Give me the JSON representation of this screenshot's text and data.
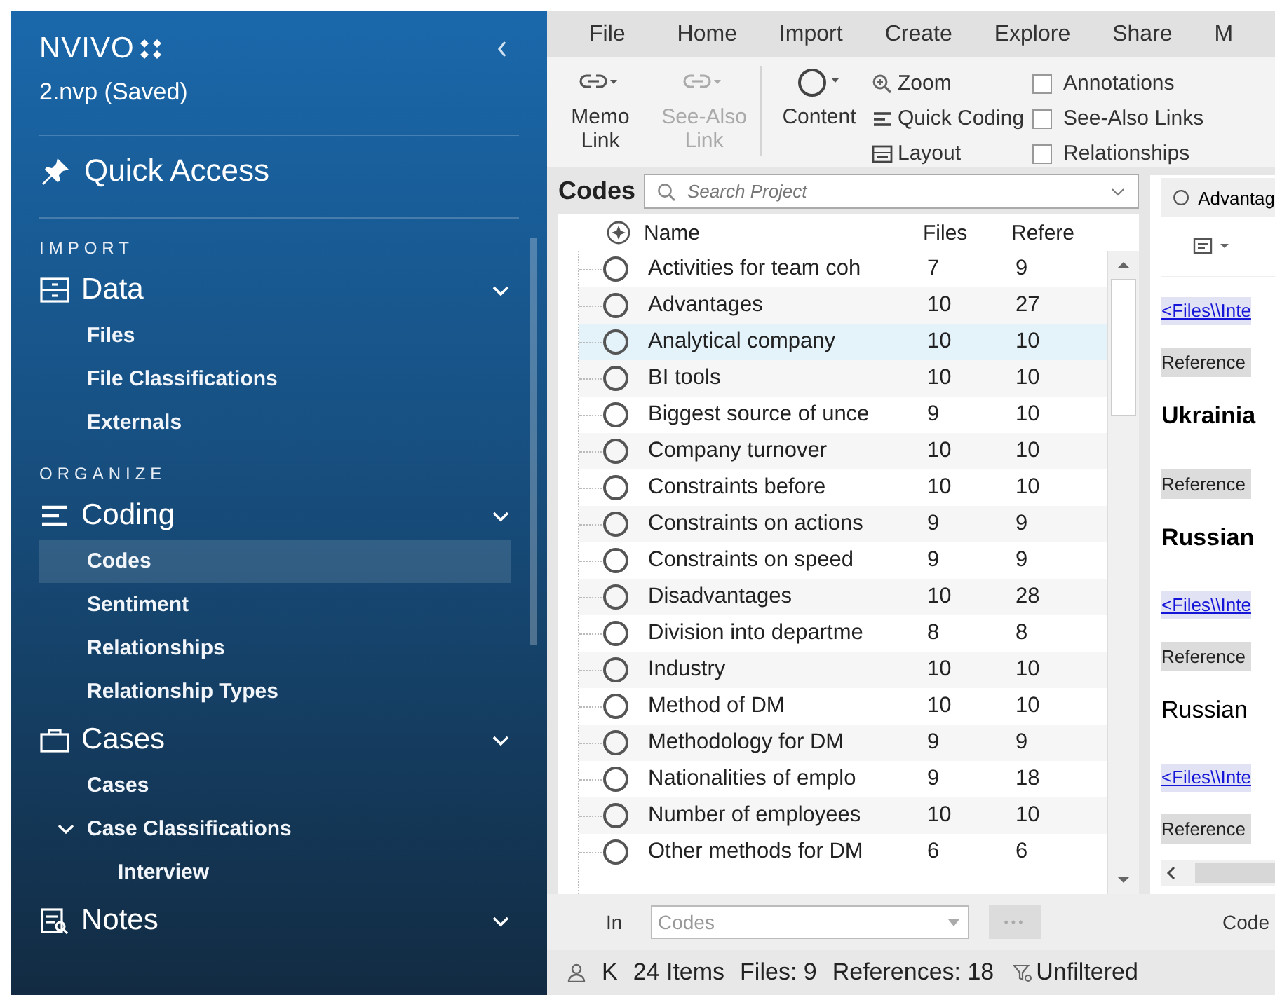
{
  "app": {
    "logo": "NVIVO",
    "project": "2.nvp (Saved)"
  },
  "sidebar": {
    "quick_access": "Quick Access",
    "sections": [
      {
        "heading": "IMPORT",
        "groups": [
          {
            "kind": "data",
            "label": "Data",
            "expanded": true,
            "items": [
              {
                "label": "Files",
                "selected": false
              },
              {
                "label": "File Classifications",
                "selected": false
              },
              {
                "label": "Externals",
                "selected": false
              }
            ]
          }
        ]
      },
      {
        "heading": "ORGANIZE",
        "groups": [
          {
            "kind": "coding",
            "label": "Coding",
            "expanded": true,
            "items": [
              {
                "label": "Codes",
                "selected": true
              },
              {
                "label": "Sentiment",
                "selected": false
              },
              {
                "label": "Relationships",
                "selected": false
              },
              {
                "label": "Relationship Types",
                "selected": false
              }
            ]
          },
          {
            "kind": "cases",
            "label": "Cases",
            "expanded": true,
            "items": [
              {
                "label": "Cases",
                "selected": false
              },
              {
                "label": "Case Classifications",
                "selected": false,
                "expanded": true,
                "children": [
                  {
                    "label": "Interview",
                    "selected": false
                  }
                ]
              }
            ]
          },
          {
            "kind": "notes",
            "label": "Notes"
          }
        ]
      }
    ]
  },
  "menu": [
    {
      "label": "File",
      "selected": false
    },
    {
      "label": "Home",
      "selected": false
    },
    {
      "label": "Import",
      "selected": false
    },
    {
      "label": "Create",
      "selected": false
    },
    {
      "label": "Explore",
      "selected": false
    },
    {
      "label": "Share",
      "selected": false
    },
    {
      "label": "M",
      "selected": false
    }
  ],
  "ribbon": {
    "links": [
      {
        "label": "Memo Link",
        "disabled": false
      },
      {
        "label": "See-Also Link",
        "disabled": true
      }
    ],
    "content": "Content",
    "tools": [
      {
        "kind": "zoom",
        "label": "Zoom"
      },
      {
        "kind": "quick",
        "label": "Quick Coding"
      },
      {
        "kind": "layout",
        "label": "Layout"
      }
    ],
    "checkboxes": [
      {
        "label": "Annotations",
        "checked": false
      },
      {
        "label": "See-Also Links",
        "checked": false
      },
      {
        "label": "Relationships",
        "checked": false
      }
    ]
  },
  "codes": {
    "title": "Codes",
    "search": {
      "placeholder": "Search Project"
    },
    "columns": [
      "Name",
      "Files",
      "Refere"
    ],
    "rows": [
      {
        "name": "Activities for team coh",
        "files": "7",
        "references": "9",
        "selected": false
      },
      {
        "name": "Advantages",
        "files": "10",
        "references": "27",
        "selected": false
      },
      {
        "name": "Analytical company",
        "files": "10",
        "references": "10",
        "selected": true
      },
      {
        "name": "BI tools",
        "files": "10",
        "references": "10",
        "selected": false
      },
      {
        "name": "Biggest source of unce",
        "files": "9",
        "references": "10",
        "selected": false
      },
      {
        "name": "Company turnover",
        "files": "10",
        "references": "10",
        "selected": false
      },
      {
        "name": "Constraints before",
        "files": "10",
        "references": "10",
        "selected": false
      },
      {
        "name": "Constraints on actions",
        "files": "9",
        "references": "9",
        "selected": false
      },
      {
        "name": "Constraints on speed",
        "files": "9",
        "references": "9",
        "selected": false
      },
      {
        "name": "Disadvantages",
        "files": "10",
        "references": "28",
        "selected": false
      },
      {
        "name": "Division into departme",
        "files": "8",
        "references": "8",
        "selected": false
      },
      {
        "name": "Industry",
        "files": "10",
        "references": "10",
        "selected": false
      },
      {
        "name": "Method of DM",
        "files": "10",
        "references": "10",
        "selected": false
      },
      {
        "name": "Methodology for DM",
        "files": "9",
        "references": "9",
        "selected": false
      },
      {
        "name": "Nationalities of emplo",
        "files": "9",
        "references": "18",
        "selected": false
      },
      {
        "name": "Number of employees",
        "files": "10",
        "references": "10",
        "selected": false
      },
      {
        "name": "Other methods for DM",
        "files": "6",
        "references": "6",
        "selected": false
      }
    ]
  },
  "detail": {
    "tab": "Advantag",
    "blocks": [
      {
        "kind": "link",
        "text": "<Files\\\\Inte"
      },
      {
        "kind": "reference",
        "text": "Reference"
      },
      {
        "kind": "bold",
        "text": "Ukrainia"
      },
      {
        "kind": "reference",
        "text": "Reference"
      },
      {
        "kind": "bold",
        "text": "Russian"
      },
      {
        "kind": "link",
        "text": "<Files\\\\Inte"
      },
      {
        "kind": "reference",
        "text": "Reference"
      },
      {
        "kind": "plain",
        "text": "Russian"
      },
      {
        "kind": "link",
        "text": "<Files\\\\Inte"
      },
      {
        "kind": "reference",
        "text": "Reference"
      }
    ]
  },
  "bottom": {
    "in_label": "In",
    "scope": "Codes",
    "more": "•••",
    "code_label": "Code"
  },
  "status": {
    "user": "K",
    "items": "24 Items",
    "files": "Files: 9",
    "references": "References: 18",
    "filter": "Unfiltered"
  }
}
